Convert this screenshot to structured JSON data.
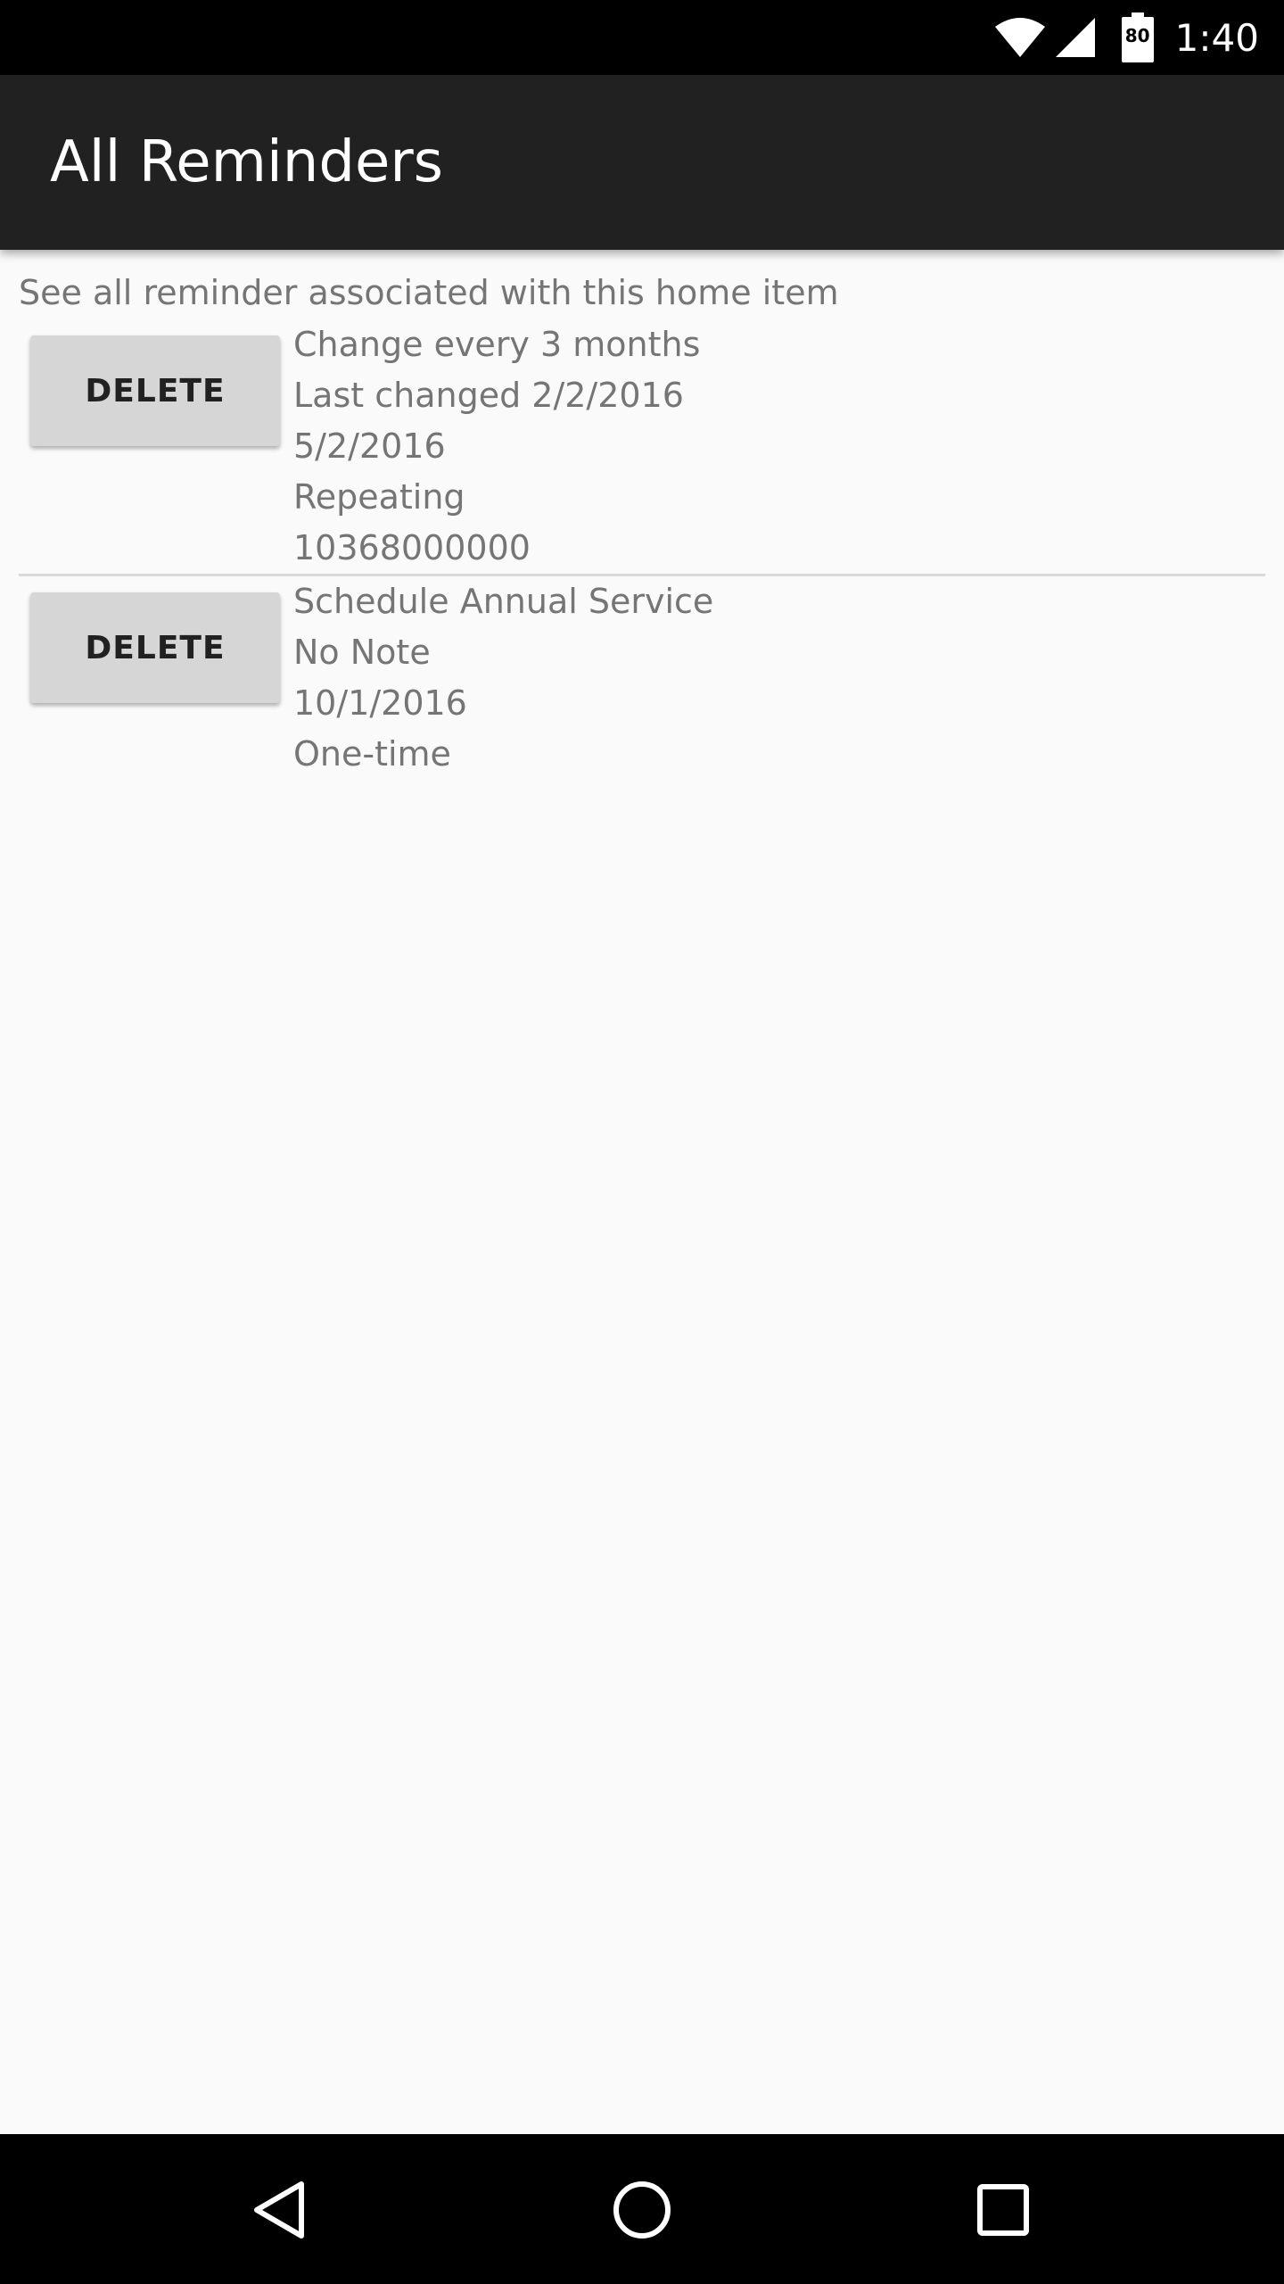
{
  "status_bar": {
    "time": "1:40",
    "battery_level": "80",
    "icons": [
      "wifi-icon",
      "cell-signal-icon",
      "battery-icon"
    ]
  },
  "app_bar": {
    "title": "All Reminders"
  },
  "content": {
    "subtitle": "See all reminder associated with this home item",
    "reminders": [
      {
        "delete_label": "DELETE",
        "lines": [
          "Change every 3 months",
          "Last changed 2/2/2016",
          "5/2/2016",
          "Repeating",
          "10368000000"
        ]
      },
      {
        "delete_label": "DELETE",
        "lines": [
          "Schedule Annual Service",
          "No Note",
          "10/1/2016",
          "One-time"
        ]
      }
    ]
  },
  "nav_bar": {
    "icons": [
      "back-icon",
      "home-icon",
      "recents-icon"
    ]
  },
  "colors": {
    "status_bar": "#000000",
    "app_bar": "#212121",
    "background": "#fafafa",
    "button": "#d6d6d6",
    "secondary_text": "#757575"
  }
}
